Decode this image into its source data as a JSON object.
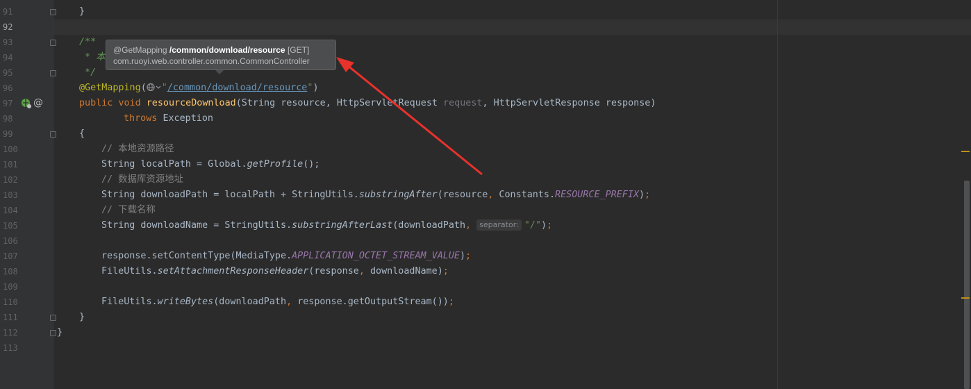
{
  "line_numbers": [
    "91",
    "92",
    "93",
    "94",
    "95",
    "96",
    "97",
    "98",
    "99",
    "100",
    "101",
    "102",
    "103",
    "104",
    "105",
    "106",
    "107",
    "108",
    "109",
    "110",
    "111",
    "112",
    "113"
  ],
  "code": {
    "l91": "}",
    "l93": "/**",
    "l94": " * 本",
    "l95": " */",
    "l96_ann": "@GetMapping",
    "l96_open": "(",
    "l96_q1": "\"",
    "l96_p1": "/",
    "l96_p2": "common",
    "l96_p3": "/",
    "l96_p4": "download",
    "l96_p5": "/",
    "l96_p6": "resource",
    "l96_q2": "\"",
    "l96_close": ")",
    "l97_kw1": "public",
    "l97_kw2": "void",
    "l97_fn": "resourceDownload",
    "l97_a": "(String resource, HttpServletRequest ",
    "l97_b": "request",
    "l97_c": ", HttpServletResponse response)",
    "l98_kw": "throws",
    "l98_rest": "Exception",
    "l99": "{",
    "l100": "// 本地资源路径",
    "l101_a": "String localPath = Global.",
    "l101_b": "getProfile",
    "l101_c": "();",
    "l102": "// 数据库资源地址",
    "l103_a": "String downloadPath = localPath + StringUtils.",
    "l103_b": "substringAfter",
    "l103_c": "(resource",
    "l103_d": ", ",
    "l103_e": "Constants.",
    "l103_f": "RESOURCE_PREFIX",
    "l103_g": ")",
    "l103_h": ";",
    "l104": "// 下载名称",
    "l105_a": "String downloadName = StringUtils.",
    "l105_b": "substringAfterLast",
    "l105_c": "(downloadPath",
    "l105_d": ", ",
    "l105_hint": "separator:",
    "l105_e": "\"/\"",
    "l105_f": ")",
    "l105_g": ";",
    "l107_a": "response.setContentType(MediaType.",
    "l107_b": "APPLICATION_OCTET_STREAM_VALUE",
    "l107_c": ")",
    "l107_d": ";",
    "l108_a": "FileUtils.",
    "l108_b": "setAttachmentResponseHeader",
    "l108_c": "(response",
    "l108_d": ", ",
    "l108_e": "downloadName)",
    "l108_f": ";",
    "l110_a": "FileUtils.",
    "l110_b": "writeBytes",
    "l110_c": "(downloadPath",
    "l110_d": ", ",
    "l110_e": "response.getOutputStream())",
    "l110_f": ";",
    "l111": "}",
    "l112": "}"
  },
  "tooltip": {
    "annotation": "@GetMapping",
    "path": "/common/download/resource",
    "method": "[GET]",
    "class_name": "com.ruoyi.web.controller.common.CommonController"
  },
  "gutter_icons": [
    "web-endpoint-icon",
    "annotation-at-icon",
    "globe-icon"
  ],
  "colors": {
    "background": "#2b2b2b",
    "keyword": "#cc7832",
    "annotation": "#bbb529",
    "string": "#6a8759",
    "method": "#ffc66d",
    "constant": "#9876aa",
    "arrow": "#e8322c"
  }
}
